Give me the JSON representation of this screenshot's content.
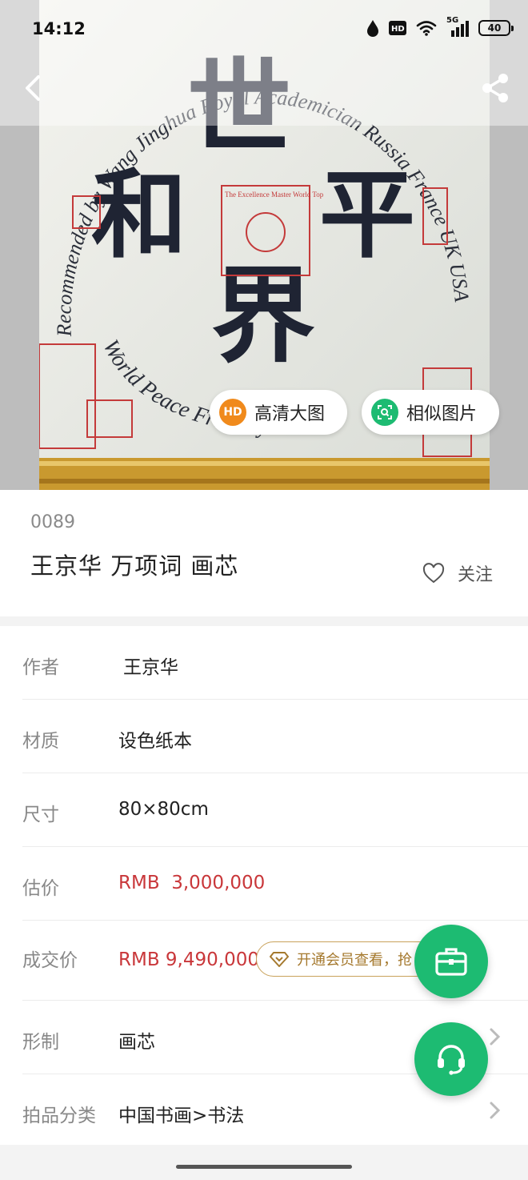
{
  "status_bar": {
    "time": "14:12",
    "network": "5G",
    "battery": "40"
  },
  "hero": {
    "artwork_text": {
      "char_1": "世",
      "char_2": "界",
      "char_3": "和",
      "char_4": "平",
      "ring_text_top": "Recommended by Wang Jinghua Royal Academician Russia France UK USA",
      "ring_text_bottom": "World Peace Friendly Peace",
      "seal_text": "The Excellence Master World Top"
    },
    "hd_button": {
      "badge": "HD",
      "label": "高清大图"
    },
    "similar_button": {
      "label": "相似图片"
    }
  },
  "lot": {
    "number": "0089",
    "title": "王京华 万项词 画芯",
    "follow_label": "关注"
  },
  "details": [
    {
      "key": "作者",
      "value": "王京华"
    },
    {
      "key": "材质",
      "value": "设色纸本"
    },
    {
      "key": "尺寸",
      "value": "80×80cm"
    },
    {
      "key": "估价",
      "value": "RMB  3,000,000"
    },
    {
      "key": "成交价",
      "value": "RMB 9,490,000",
      "member_prompt": "开通会员查看，抢"
    },
    {
      "key": "形制",
      "value": "画芯"
    },
    {
      "key": "拍品分类",
      "value": "中国书画>书法"
    }
  ],
  "colors": {
    "accent_green": "#1dbb72",
    "price_red": "#c9373a",
    "member_gold": "#c9a25b",
    "hd_orange": "#f08a1c"
  },
  "icons": {
    "back": "chevron-left-icon",
    "share": "share-icon",
    "follow": "heart-outline-icon",
    "fab_top": "briefcase-icon",
    "fab_bottom": "headset-icon"
  }
}
